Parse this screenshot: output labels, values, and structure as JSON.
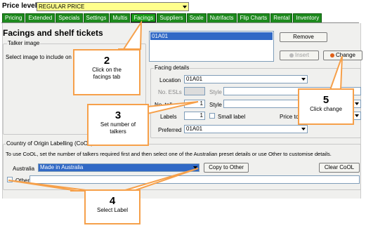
{
  "price_level": {
    "label": "Price level",
    "value": "REGULAR PRICE"
  },
  "tabs": [
    "Pricing",
    "Extended",
    "Specials",
    "Settings",
    "Multis",
    "Facings",
    "Suppliers",
    "Scale",
    "Nutrifacts",
    "Flip Charts",
    "Rental",
    "Inventory"
  ],
  "page": {
    "title": "Facings and shelf tickets"
  },
  "talker_image": {
    "group": "Talker image",
    "prompt": "Select image to include on"
  },
  "facings_list": {
    "selected": "01A01"
  },
  "buttons": {
    "remove": "Remove",
    "insert": "Insert",
    "change": "Change",
    "copy_to_other": "Copy to Other",
    "clear_cool": "Clear CoOL"
  },
  "facing_details": {
    "group": "Facing details",
    "location_label": "Location",
    "location_value": "01A01",
    "no_esls_label": "No. ESLs",
    "style_label": "Style",
    "no_talkers_label": "No. talkers",
    "no_talkers_value": "1",
    "labels_label": "Labels",
    "labels_value": "1",
    "small_label": "Small label",
    "price_to_label": "Price to",
    "preferred_label": "Preferred",
    "preferred_value": "01A01"
  },
  "cool": {
    "group": "Country of Origin Labelling (CoOL)",
    "instructions": "To use CoOL, set the number of talkers required first and then select one of the Australian preset details or use Other to customise details.",
    "australia_label": "Australia",
    "australia_value": "Made in Australia",
    "other_label": "Other"
  },
  "callouts": {
    "c2": {
      "num": "2",
      "text": "Click on the facings tab"
    },
    "c3": {
      "num": "3",
      "text": "Set number of talkers"
    },
    "c4": {
      "num": "4",
      "text": "Select Label"
    },
    "c5": {
      "num": "5",
      "text": "Click change"
    }
  },
  "colors": {
    "tab_green": "#1d8a1d",
    "price_yellow": "#ffff8c",
    "callout_border": "#f6a04a",
    "selection_blue": "#3169c6"
  }
}
